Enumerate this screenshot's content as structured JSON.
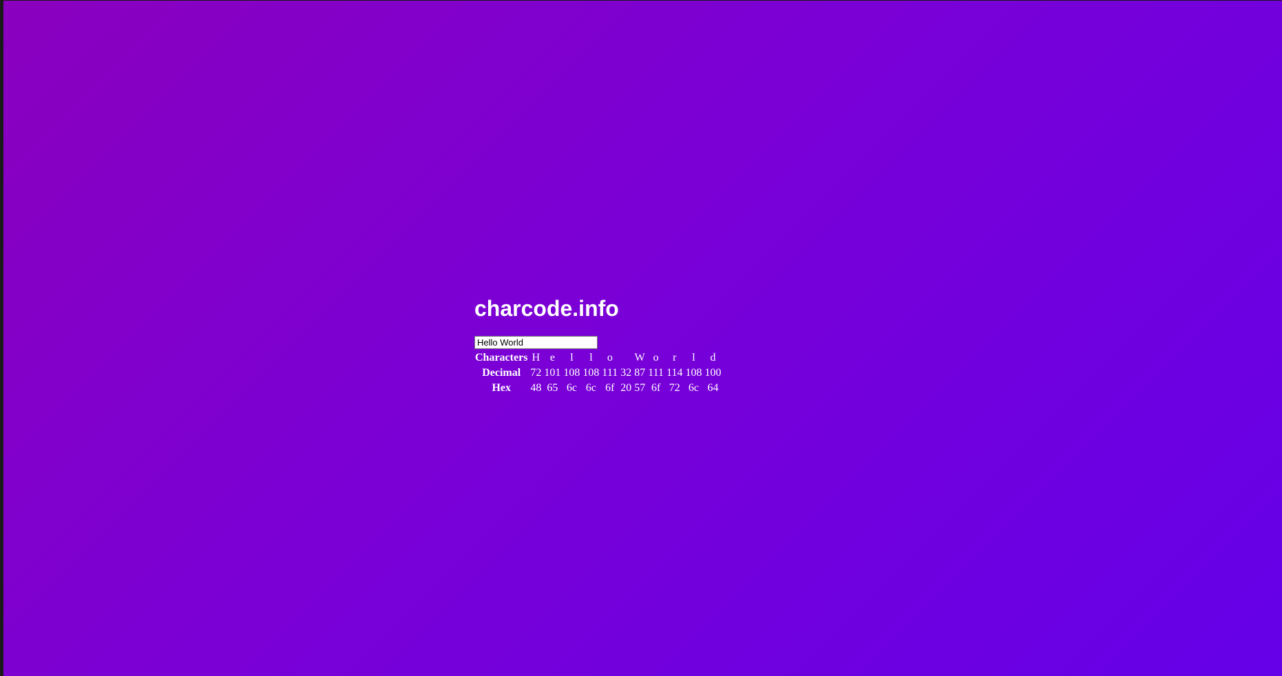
{
  "page": {
    "title": "charcode.info",
    "colors": {
      "gradient_start": "#8a00be",
      "gradient_end": "#6500e8",
      "text": "#ffffff"
    }
  },
  "input": {
    "value": "Hello World"
  },
  "table": {
    "row_labels": {
      "characters": "Characters",
      "decimal": "Decimal",
      "hex": "Hex"
    },
    "characters": [
      "H",
      "e",
      "l",
      "l",
      "o",
      " ",
      "W",
      "o",
      "r",
      "l",
      "d"
    ],
    "decimal": [
      "72",
      "101",
      "108",
      "108",
      "111",
      "32",
      "87",
      "111",
      "114",
      "108",
      "100"
    ],
    "hex": [
      "48",
      "65",
      "6c",
      "6c",
      "6f",
      "20",
      "57",
      "6f",
      "72",
      "6c",
      "64"
    ]
  }
}
